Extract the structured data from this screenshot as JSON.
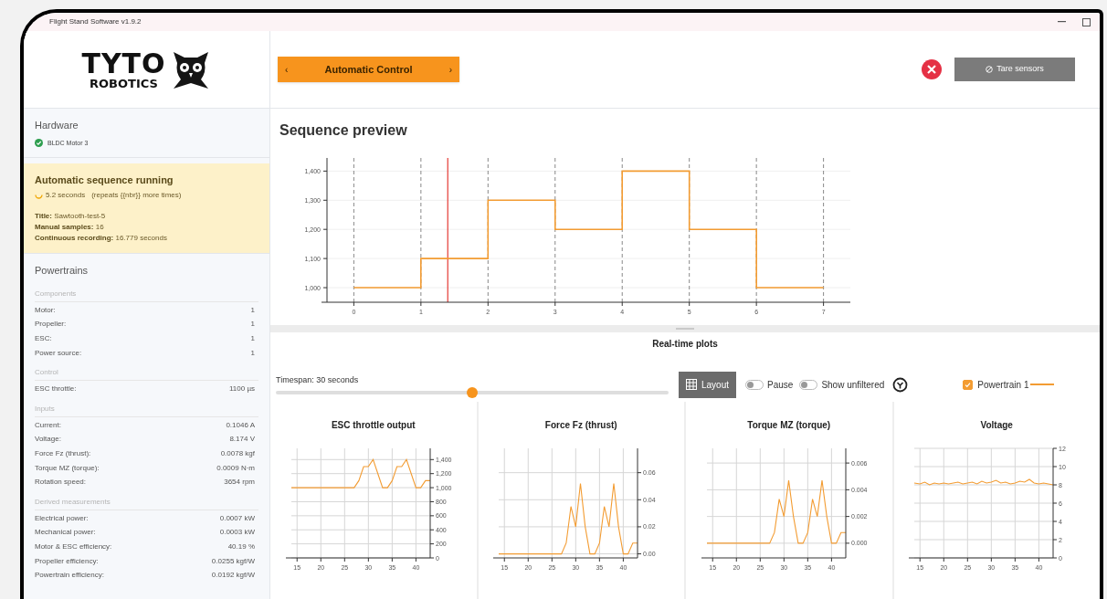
{
  "window": {
    "title": "Flight Stand Software v1.9.2"
  },
  "header": {
    "logo_text": "TYTO",
    "logo_subtext": "ROBOTICS",
    "mode_button": {
      "prev": "‹",
      "label": "Automatic Control",
      "next": "›"
    },
    "tare_button": "Tare sensors"
  },
  "sidebar": {
    "hardware": {
      "title": "Hardware",
      "devices": [
        {
          "name": "BLDC Motor 3",
          "connected": true
        }
      ]
    },
    "sequence": {
      "title": "Automatic sequence running",
      "elapsed": "5.2 seconds",
      "repeats": "(repeats {{nbr}} more times)",
      "fields": [
        {
          "label": "Title:",
          "value": "Sawtooth-test-5"
        },
        {
          "label": "Manual samples:",
          "value": "16"
        },
        {
          "label": "Continuous recording:",
          "value": "16.779 seconds"
        }
      ]
    },
    "powertrains": {
      "title": "Powertrains",
      "groups": [
        {
          "title": "Components",
          "rows": [
            {
              "label": "Motor:",
              "value": "1"
            },
            {
              "label": "Propeller:",
              "value": "1"
            },
            {
              "label": "ESC:",
              "value": "1"
            },
            {
              "label": "Power source:",
              "value": "1"
            }
          ]
        },
        {
          "title": "Control",
          "rows": [
            {
              "label": "ESC throttle:",
              "value": "1100 µs"
            }
          ]
        },
        {
          "title": "Inputs",
          "rows": [
            {
              "label": "Current:",
              "value": "0.1046 A"
            },
            {
              "label": "Voltage:",
              "value": "8.174 V"
            },
            {
              "label": "Force Fz (thrust):",
              "value": "0.0078 kgf"
            },
            {
              "label": "Torque MZ (torque):",
              "value": "0.0009 N·m"
            },
            {
              "label": "Rotation speed:",
              "value": "3654 rpm"
            }
          ]
        },
        {
          "title": "Derived measurements",
          "rows": [
            {
              "label": "Electrical power:",
              "value": "0.0007 kW"
            },
            {
              "label": "Mechanical power:",
              "value": "0.0003 kW"
            },
            {
              "label": "Motor & ESC efficiency:",
              "value": "40.19 %"
            },
            {
              "label": "Propeller efficiency:",
              "value": "0.0255 kgf/W"
            },
            {
              "label": "Powertrain efficiency:",
              "value": "0.0192 kgf/W"
            }
          ]
        }
      ]
    }
  },
  "sequence_preview": {
    "title": "Sequence preview",
    "chart_data": {
      "type": "line",
      "x": [
        0,
        1,
        1,
        2,
        2,
        3,
        3,
        4,
        4,
        5,
        5,
        6,
        6,
        7
      ],
      "grid": true,
      "series": [
        {
          "color": "#f39c32",
          "values": [
            1000,
            1000,
            1100,
            1100,
            1300,
            1300,
            1200,
            1200,
            1400,
            1400,
            1200,
            1200,
            1000,
            1000
          ]
        }
      ],
      "xlim": [
        -0.4,
        7.4
      ],
      "ylim": [
        950,
        1445
      ],
      "xticks": [
        0,
        1,
        2,
        3,
        4,
        5,
        6,
        7
      ],
      "yticks": [
        {
          "value": 1000,
          "label": "1,000"
        },
        {
          "value": 1100,
          "label": "1,100"
        },
        {
          "value": 1200,
          "label": "1,200"
        },
        {
          "value": 1300,
          "label": "1,300"
        },
        {
          "value": 1400,
          "label": "1,400"
        }
      ],
      "ref_lines": [
        {
          "axis": "x",
          "value": 1.4,
          "color": "#e53935"
        }
      ]
    }
  },
  "realtime": {
    "title": "Real-time plots",
    "timespan_label": "Timespan: 30 seconds",
    "timespan_slider": {
      "level": 0.5
    },
    "layout_button": "Layout",
    "toggles": [
      {
        "label": "Pause",
        "on": false
      },
      {
        "label": "Show unfiltered",
        "on": false
      }
    ],
    "powertrain_legend": {
      "label": "Powertrain 1",
      "checked": true,
      "color": "#f39c32"
    },
    "plots": [
      {
        "title": "ESC throttle output",
        "chart_data": {
          "type": "line",
          "x": [
            13.8,
            15,
            16,
            17,
            18,
            19,
            20,
            21,
            22,
            23,
            24,
            25,
            26,
            27,
            28,
            29,
            30,
            31,
            32,
            33,
            34,
            35,
            36,
            37,
            38,
            39,
            40,
            41,
            42,
            43
          ],
          "grid": true,
          "series": [
            {
              "color": "#f39c32",
              "values": [
                1000,
                1000,
                1000,
                1000,
                1000,
                1000,
                1000,
                1000,
                1000,
                1000,
                1000,
                1000,
                1000,
                1000,
                1100,
                1300,
                1300,
                1400,
                1200,
                1000,
                1000,
                1100,
                1300,
                1300,
                1400,
                1200,
                1000,
                1000,
                1100,
                1100
              ]
            }
          ],
          "xlim": [
            13.8,
            43
          ],
          "ylim": [
            0,
            1560
          ],
          "xticks": [
            15,
            20,
            25,
            30,
            35,
            40
          ],
          "yticks": [
            0,
            200,
            400,
            600,
            800,
            {
              "value": 1000,
              "label": "1,000"
            },
            {
              "value": 1200,
              "label": "1,200"
            },
            {
              "value": 1400,
              "label": "1,400"
            }
          ]
        }
      },
      {
        "title": "Force Fz (thrust)",
        "chart_data": {
          "type": "line",
          "x": [
            13.8,
            15,
            16,
            17,
            18,
            19,
            20,
            21,
            22,
            23,
            24,
            25,
            26,
            27,
            28,
            29,
            30,
            31,
            32,
            33,
            34,
            35,
            36,
            37,
            38,
            39,
            40,
            41,
            42,
            43
          ],
          "grid": true,
          "series": [
            {
              "color": "#f39c32",
              "values": [
                0,
                0,
                0,
                0,
                0,
                0,
                0,
                0,
                0,
                0,
                0,
                0,
                0,
                0,
                0.008,
                0.035,
                0.02,
                0.052,
                0.02,
                0,
                0,
                0.008,
                0.035,
                0.02,
                0.052,
                0.02,
                0,
                0,
                0.008,
                0.008
              ]
            }
          ],
          "xlim": [
            13.8,
            43
          ],
          "ylim": [
            -0.003,
            0.078
          ],
          "xticks": [
            15,
            20,
            25,
            30,
            35,
            40
          ],
          "yticks": [
            {
              "value": 0,
              "label": "0.00"
            },
            {
              "value": 0.02,
              "label": "0.02"
            },
            {
              "value": 0.04,
              "label": "0.04"
            },
            {
              "value": 0.06,
              "label": "0.06"
            }
          ]
        }
      },
      {
        "title": "Torque MZ (torque)",
        "chart_data": {
          "type": "line",
          "x": [
            13.8,
            15,
            16,
            17,
            18,
            19,
            20,
            21,
            22,
            23,
            24,
            25,
            26,
            27,
            28,
            29,
            30,
            31,
            32,
            33,
            34,
            35,
            36,
            37,
            38,
            39,
            40,
            41,
            42,
            43
          ],
          "grid": true,
          "series": [
            {
              "color": "#f39c32",
              "values": [
                0,
                0,
                0,
                0,
                0,
                0,
                0,
                0,
                0,
                0,
                0,
                0,
                0,
                0,
                0.0008,
                0.0033,
                0.002,
                0.0047,
                0.002,
                0,
                0,
                0.0008,
                0.0033,
                0.002,
                0.0047,
                0.002,
                0,
                0,
                0.0008,
                0.0008
              ]
            }
          ],
          "xlim": [
            13.8,
            43
          ],
          "ylim": [
            -0.0011,
            0.0071
          ],
          "xticks": [
            15,
            20,
            25,
            30,
            35,
            40
          ],
          "yticks": [
            {
              "value": 0,
              "label": "0.000"
            },
            {
              "value": 0.002,
              "label": "0.002"
            },
            {
              "value": 0.004,
              "label": "0.004"
            },
            {
              "value": 0.006,
              "label": "0.006"
            }
          ]
        }
      },
      {
        "title": "Voltage",
        "chart_data": {
          "type": "line",
          "x": [
            13.8,
            15,
            16,
            17,
            18,
            19,
            20,
            21,
            22,
            23,
            24,
            25,
            26,
            27,
            28,
            29,
            30,
            31,
            32,
            33,
            34,
            35,
            36,
            37,
            38,
            39,
            40,
            41,
            42,
            43
          ],
          "grid": true,
          "series": [
            {
              "color": "#f39c32",
              "values": [
                8.2,
                8.1,
                8.3,
                8.0,
                8.2,
                8.1,
                8.2,
                8.1,
                8.2,
                8.3,
                8.1,
                8.2,
                8.3,
                8.1,
                8.4,
                8.2,
                8.3,
                8.5,
                8.2,
                8.3,
                8.1,
                8.2,
                8.4,
                8.3,
                8.6,
                8.2,
                8.1,
                8.2,
                8.1,
                8.0
              ]
            }
          ],
          "xlim": [
            13.8,
            43
          ],
          "ylim": [
            0,
            12
          ],
          "xticks": [
            15,
            20,
            25,
            30,
            35,
            40
          ],
          "yticks": [
            0,
            2,
            4,
            6,
            8,
            10,
            12
          ]
        }
      }
    ]
  }
}
